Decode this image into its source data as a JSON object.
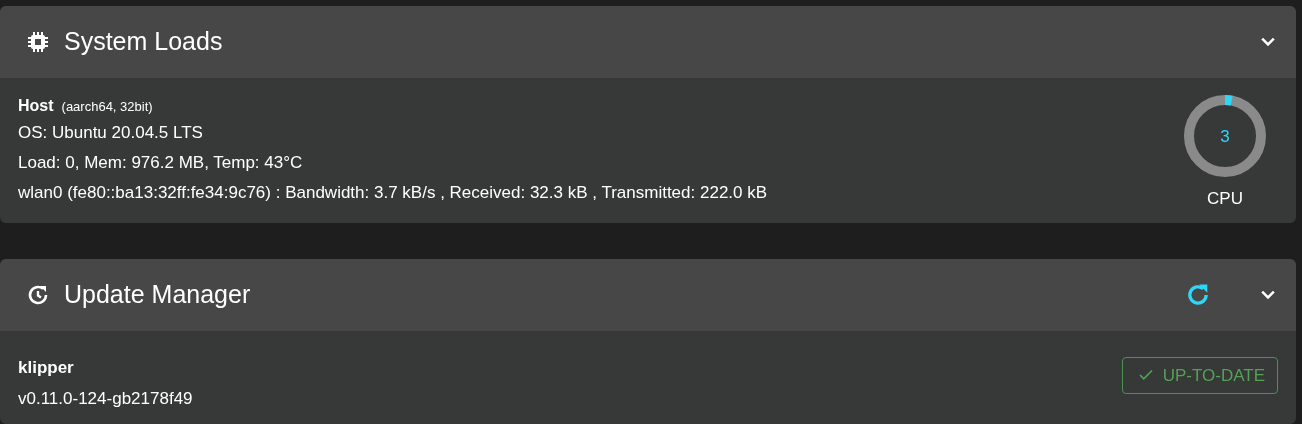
{
  "system_loads": {
    "title": "System Loads",
    "expanded": true,
    "host": {
      "label": "Host",
      "arch": "(aarch64, 32bit)"
    },
    "lines": [
      "OS: Ubuntu 20.04.5 LTS",
      "Load: 0, Mem: 976.2 MB, Temp: 43°C",
      "wlan0 (fe80::ba13:32ff:fe34:9c76) : Bandwidth: 3.7 kB/s , Received: 32.3 kB , Transmitted: 222.0 kB"
    ],
    "cpu": {
      "value": "3",
      "label": "CPU"
    }
  },
  "update_manager": {
    "title": "Update Manager",
    "expanded": true,
    "items": [
      {
        "name": "klipper",
        "version": "v0.11.0-124-gb2178f49",
        "status": "UP-TO-DATE",
        "up_to_date": true
      }
    ]
  }
}
